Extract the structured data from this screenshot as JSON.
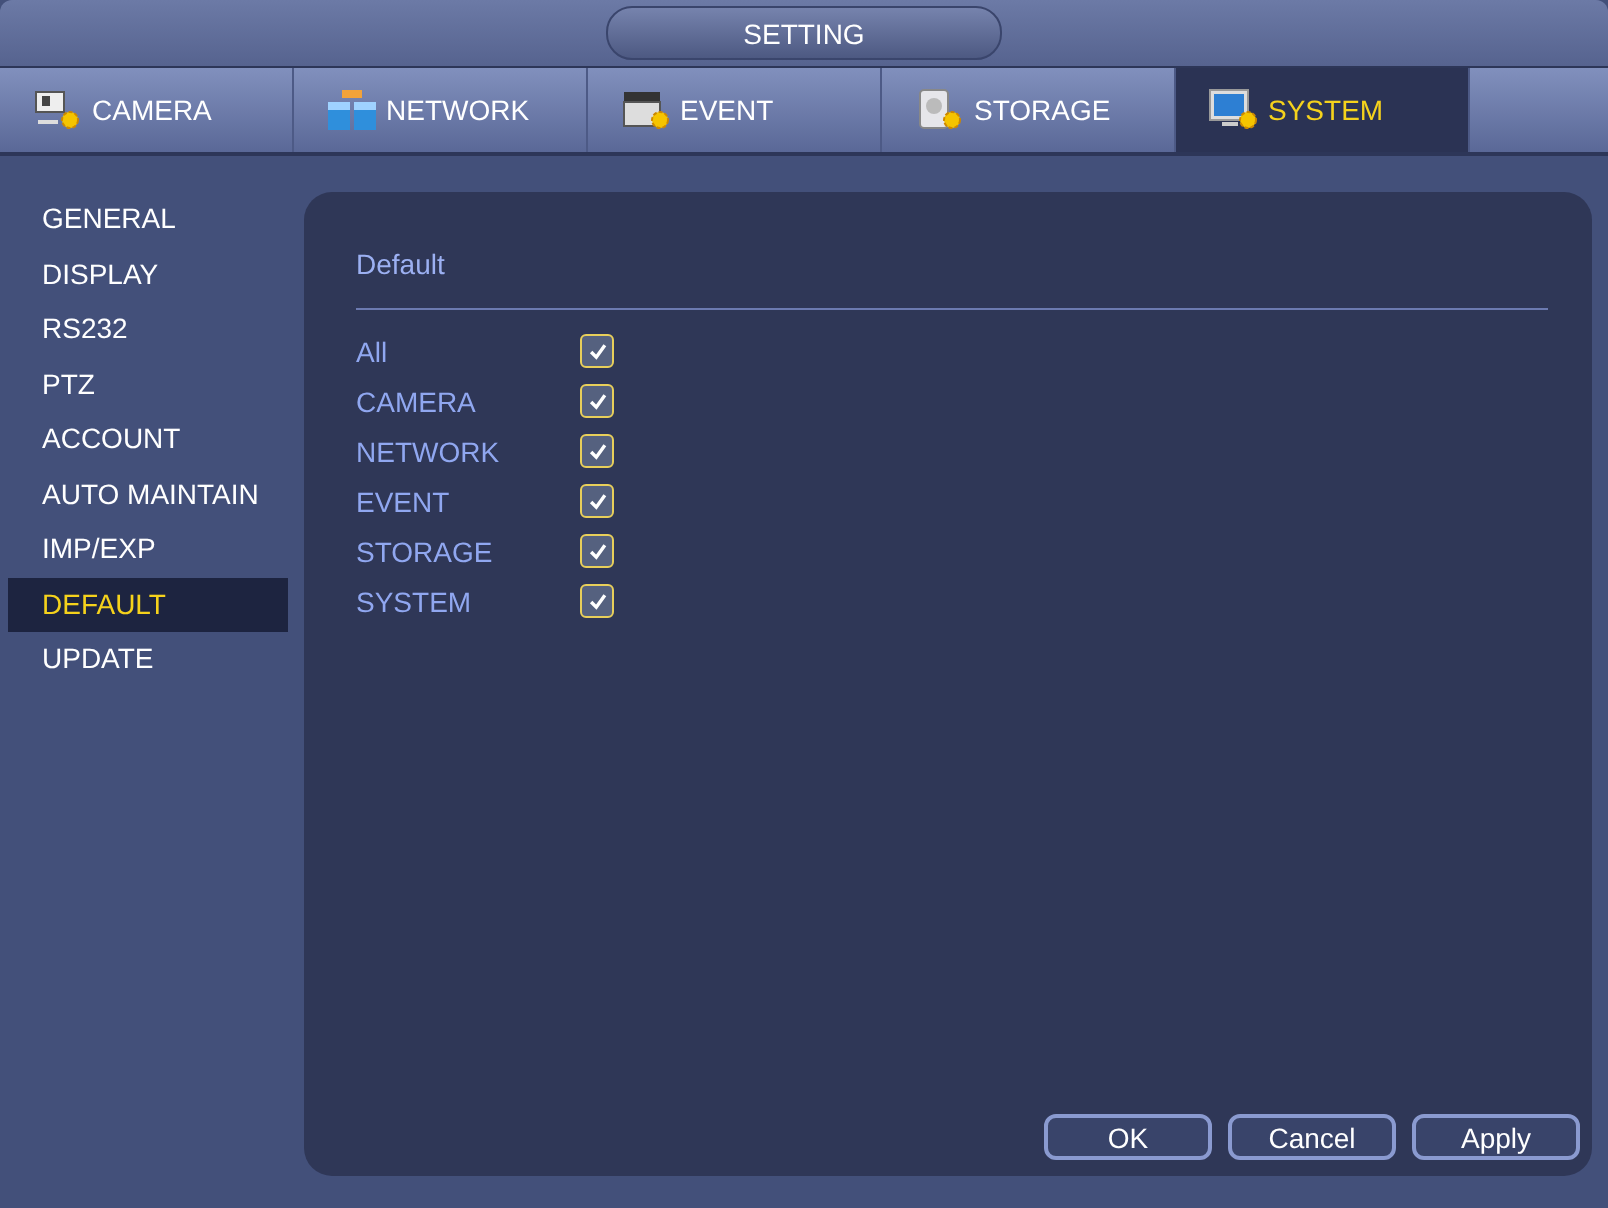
{
  "window": {
    "title": "SETTING"
  },
  "tabs": [
    {
      "label": "CAMERA",
      "selected": false
    },
    {
      "label": "NETWORK",
      "selected": false
    },
    {
      "label": "EVENT",
      "selected": false
    },
    {
      "label": "STORAGE",
      "selected": false
    },
    {
      "label": "SYSTEM",
      "selected": true
    }
  ],
  "sidebar": {
    "items": [
      {
        "label": "GENERAL",
        "selected": false
      },
      {
        "label": "DISPLAY",
        "selected": false
      },
      {
        "label": "RS232",
        "selected": false
      },
      {
        "label": "PTZ",
        "selected": false
      },
      {
        "label": "ACCOUNT",
        "selected": false
      },
      {
        "label": "AUTO MAINTAIN",
        "selected": false
      },
      {
        "label": "IMP/EXP",
        "selected": false
      },
      {
        "label": "DEFAULT",
        "selected": true
      },
      {
        "label": "UPDATE",
        "selected": false
      }
    ]
  },
  "panel": {
    "heading": "Default",
    "options": [
      {
        "label": "All",
        "checked": true
      },
      {
        "label": "CAMERA",
        "checked": true
      },
      {
        "label": "NETWORK",
        "checked": true
      },
      {
        "label": "EVENT",
        "checked": true
      },
      {
        "label": "STORAGE",
        "checked": true
      },
      {
        "label": "SYSTEM",
        "checked": true
      }
    ]
  },
  "buttons": [
    "OK",
    "Cancel",
    "Apply"
  ]
}
